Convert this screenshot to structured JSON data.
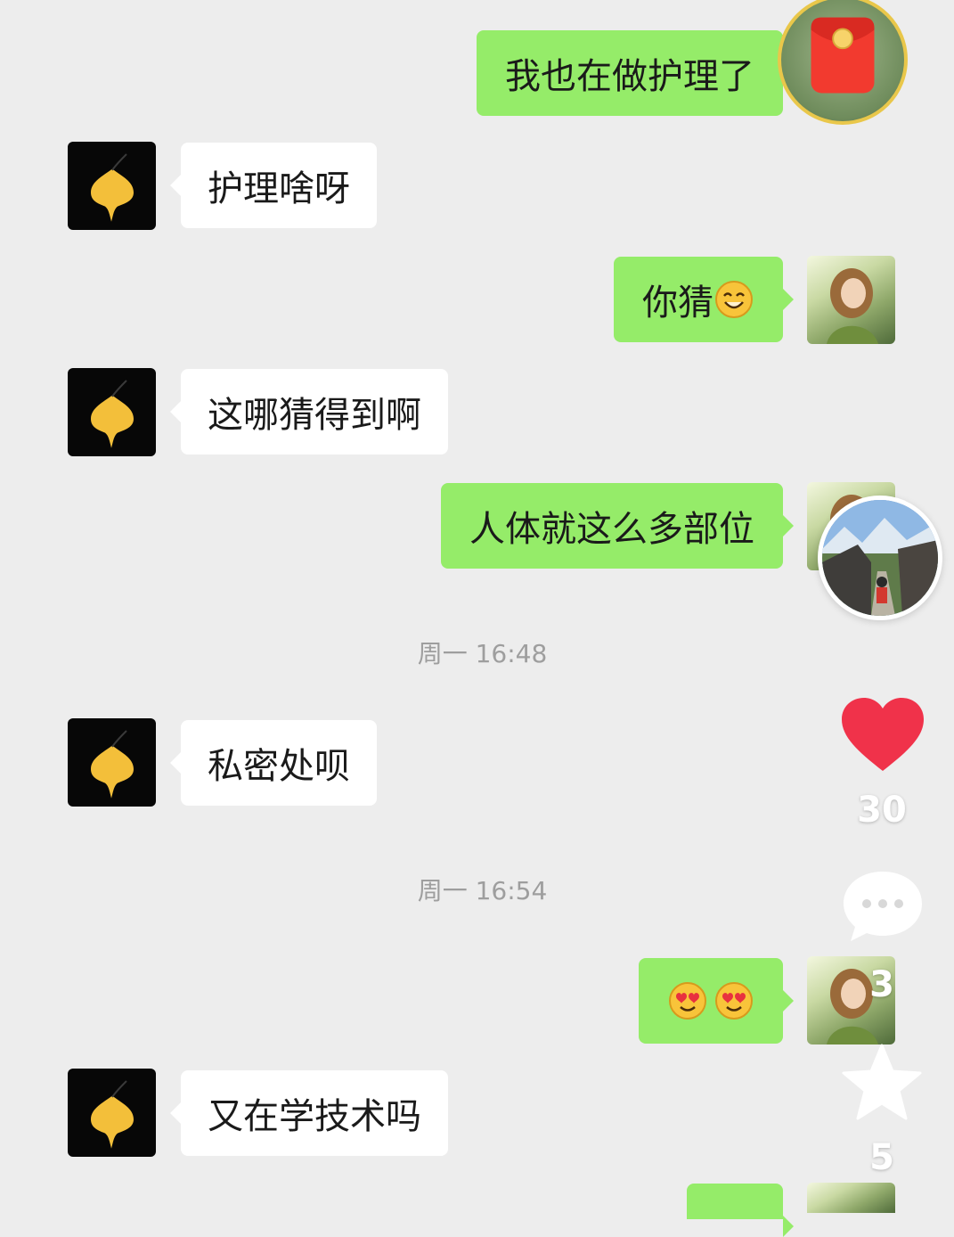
{
  "messages": [
    {
      "side": "out",
      "text": "我也在做护理了"
    },
    {
      "side": "in",
      "text": "护理啥呀"
    },
    {
      "side": "out",
      "text": "你猜",
      "emoji": "smile-emoji"
    },
    {
      "side": "in",
      "text": "这哪猜得到啊"
    },
    {
      "side": "out",
      "text": "人体就这么多部位"
    },
    {
      "side": "in",
      "text": "私密处呗"
    },
    {
      "side": "out",
      "text": "",
      "emoji": "heart-eyes-emoji ×2"
    },
    {
      "side": "in",
      "text": "又在学技术吗"
    }
  ],
  "timestamps": [
    "周一 16:48",
    "周一 16:54"
  ],
  "overlay": {
    "like_count": "30",
    "comment_count": "3",
    "favorite_count": "5",
    "icons": [
      "red-packet-icon",
      "creator-avatar",
      "heart-icon",
      "comment-icon",
      "star-icon"
    ]
  },
  "colors": {
    "background": "#ededed",
    "outgoing_bubble": "#95ec69",
    "incoming_bubble": "#ffffff",
    "like_heart": "#f0324a"
  }
}
